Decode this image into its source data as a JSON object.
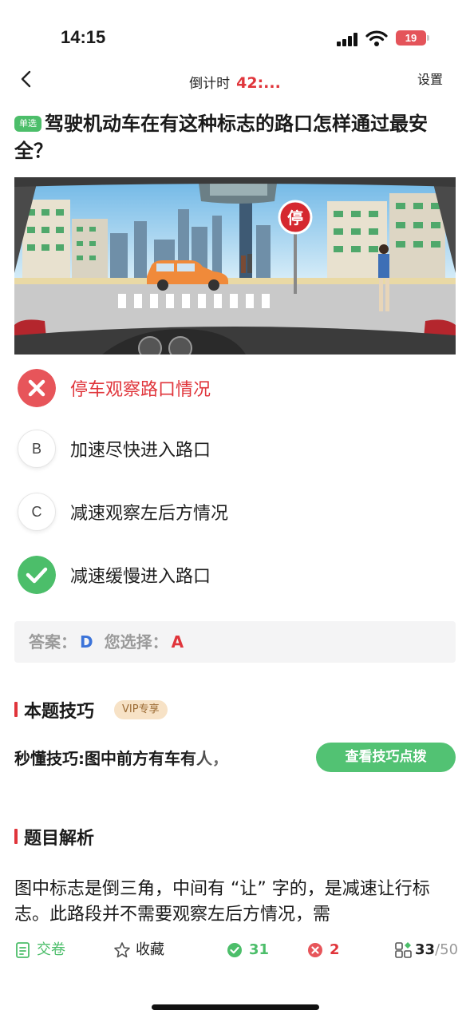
{
  "status_bar": {
    "time": "14:15",
    "battery": "19"
  },
  "nav": {
    "timer_label": "倒计时",
    "timer_value": "42:...",
    "settings": "设置"
  },
  "question": {
    "tag": "单选",
    "text": "驾驶机动车在有这种标志的路口怎样通过最安全？"
  },
  "scene": {
    "sign_text": "停"
  },
  "options": [
    {
      "letter": "A",
      "text": "停车观察路口情况",
      "state": "wrong"
    },
    {
      "letter": "B",
      "text": "加速尽快进入路口",
      "state": "normal"
    },
    {
      "letter": "C",
      "text": "减速观察左后方情况",
      "state": "normal"
    },
    {
      "letter": "D",
      "text": "减速缓慢进入路口",
      "state": "correct"
    }
  ],
  "answer": {
    "answer_label": "答案：",
    "correct": "D",
    "chosen_label": "您选择：",
    "chosen": "A"
  },
  "tips": {
    "title": "本题技巧",
    "vip": "VIP专享",
    "preview": "秒懂技巧:图中前方有车有人，",
    "button": "查看技巧点拨"
  },
  "analysis": {
    "title": "题目解析",
    "text": "图中标志是倒三角，中间有 “让” 字的，是减速让行标志。此路段并不需要观察左后方情况，需"
  },
  "bottom_bar": {
    "submit": "交卷",
    "favorite": "收藏",
    "correct_count": "31",
    "wrong_count": "2",
    "progress_current": "33",
    "progress_total": "/50"
  },
  "colors": {
    "accent_red": "#e0353b",
    "accent_green": "#4cbe6a",
    "accent_blue": "#3b73d9"
  }
}
